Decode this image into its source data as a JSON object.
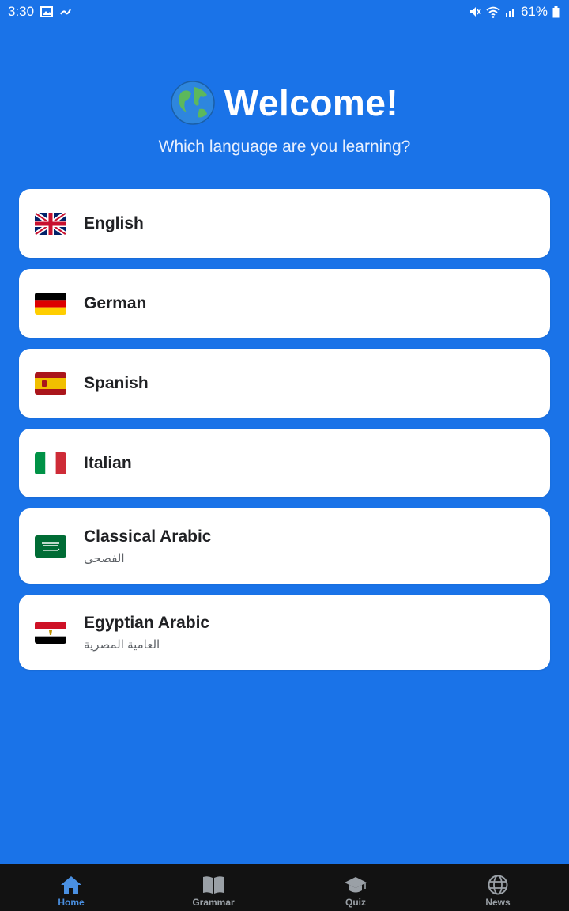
{
  "status_bar": {
    "time": "3:30",
    "battery": "61%"
  },
  "header": {
    "title": "Welcome!",
    "subtitle": "Which language are you learning?"
  },
  "languages": [
    {
      "name": "English",
      "native": "",
      "flag": "uk-flag"
    },
    {
      "name": "German",
      "native": "",
      "flag": "germany-flag"
    },
    {
      "name": "Spanish",
      "native": "",
      "flag": "spain-flag"
    },
    {
      "name": "Italian",
      "native": "",
      "flag": "italy-flag"
    },
    {
      "name": "Classical Arabic",
      "native": "الفصحى",
      "flag": "saudi-flag"
    },
    {
      "name": "Egyptian Arabic",
      "native": "العامية المصرية",
      "flag": "egypt-flag"
    }
  ],
  "nav": [
    {
      "label": "Home",
      "icon": "home-icon",
      "active": true
    },
    {
      "label": "Grammar",
      "icon": "book-icon",
      "active": false
    },
    {
      "label": "Quiz",
      "icon": "graduation-cap-icon",
      "active": false
    },
    {
      "label": "News",
      "icon": "globe-icon",
      "active": false
    }
  ],
  "colors": {
    "background": "#1A73E8",
    "card": "#FFFFFF",
    "nav_bg": "#121212",
    "nav_active": "#4A90E2"
  }
}
